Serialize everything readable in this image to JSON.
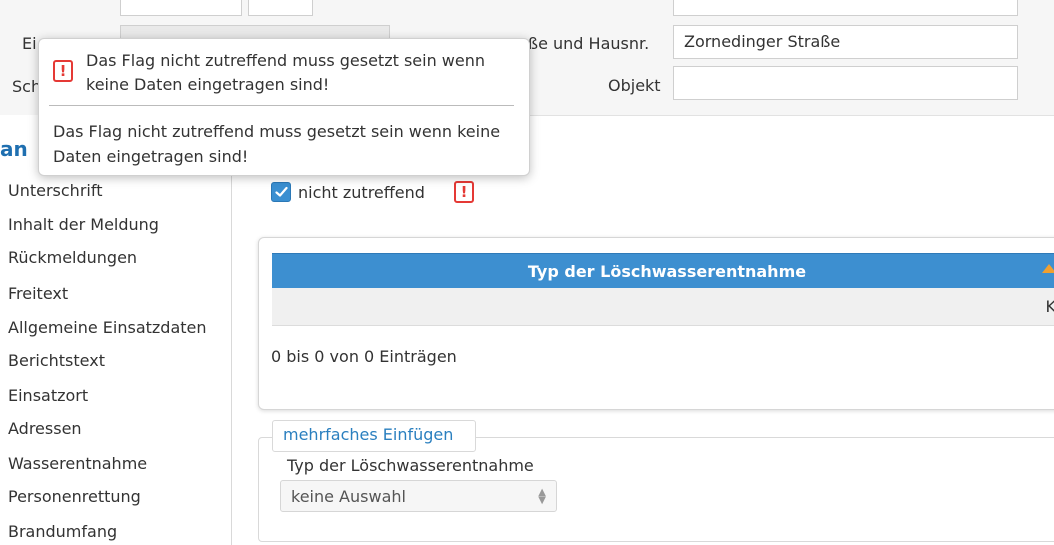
{
  "form": {
    "label_ei": "Ei",
    "label_sch": "Sch",
    "street_label": "ße und Hausnr.",
    "street_value": "Zornedinger Straße",
    "objekt_label": "Objekt",
    "objekt_value": ""
  },
  "sidebar": {
    "title": "an",
    "items": [
      {
        "label": "Unterschrift"
      },
      {
        "label": "Inhalt der Meldung"
      },
      {
        "label": "Rückmeldungen"
      },
      {
        "label": "Freitext"
      },
      {
        "label": "Allgemeine Einsatzdaten"
      },
      {
        "label": "Berichtstext"
      },
      {
        "label": "Einsatzort"
      },
      {
        "label": "Adressen"
      },
      {
        "label": "Wasserentnahme"
      },
      {
        "label": "Personenrettung"
      },
      {
        "label": "Brandumfang"
      }
    ]
  },
  "not_applicable": {
    "label": "nicht zutreffend",
    "checked": true,
    "warning_icon": "exclamation-icon"
  },
  "table": {
    "column_header": "Typ der Löschwasserentnahme",
    "row_partial": "K",
    "info": "0 bis 0 von 0 Einträgen"
  },
  "multi_insert": {
    "legend": "mehrfaches Einfügen",
    "select_label": "Typ der Löschwasserentnahme",
    "select_value": "keine Auswahl"
  },
  "tooltip": {
    "header": "Das Flag nicht zutreffend muss gesetzt sein wenn keine Daten eingetragen sind!",
    "body": "Das Flag nicht zutreffend muss gesetzt sein wenn keine Daten eingetragen sind!"
  },
  "colors": {
    "accent": "#3d8fd0",
    "warning": "#e53935",
    "sort_arrow": "#f0a030"
  }
}
